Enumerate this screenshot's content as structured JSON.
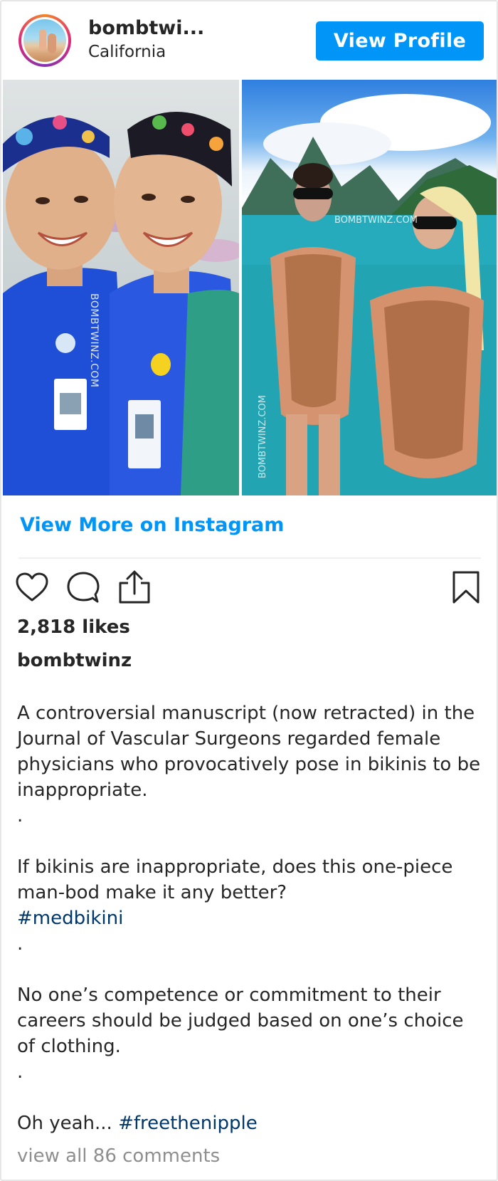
{
  "header": {
    "username": "bombtwi...",
    "location": "California",
    "view_profile_label": "View Profile",
    "avatar_icon": "profile-avatar"
  },
  "photo": {
    "watermark_left": "BOMBTWINZ.COM",
    "watermark_right_top": "BOMBTWINZ.COM",
    "watermark_right_bottom": "BOMBTWINZ.COM"
  },
  "link": {
    "view_more": "View More on Instagram"
  },
  "actions": {
    "icons": [
      "heart-icon",
      "comment-icon",
      "share-icon",
      "bookmark-icon"
    ],
    "likes": "2,818 likes"
  },
  "caption": {
    "username": "bombtwinz",
    "p1": "A controversial manuscript (now retracted) in the Journal of Vascular Surgeons regarded female physicians who provocatively pose in bikinis to be inappropriate.",
    "dot1": ".",
    "p2": "If bikinis are inappropriate, does this one-piece man-bod make it any better?",
    "hashtag1": "#medbikini",
    "dot2": ".",
    "p3": "No one’s competence or commitment to their careers should be judged based on one’s choice of clothing.",
    "dot3": ".",
    "p4_prefix": "Oh yeah... ",
    "hashtag2": "#freethenipple"
  },
  "comments": {
    "view_all": "view all 86 comments"
  },
  "colors": {
    "accent": "#0095f6",
    "hashtag": "#00376b",
    "muted": "#8e8e8e",
    "text": "#262626"
  }
}
